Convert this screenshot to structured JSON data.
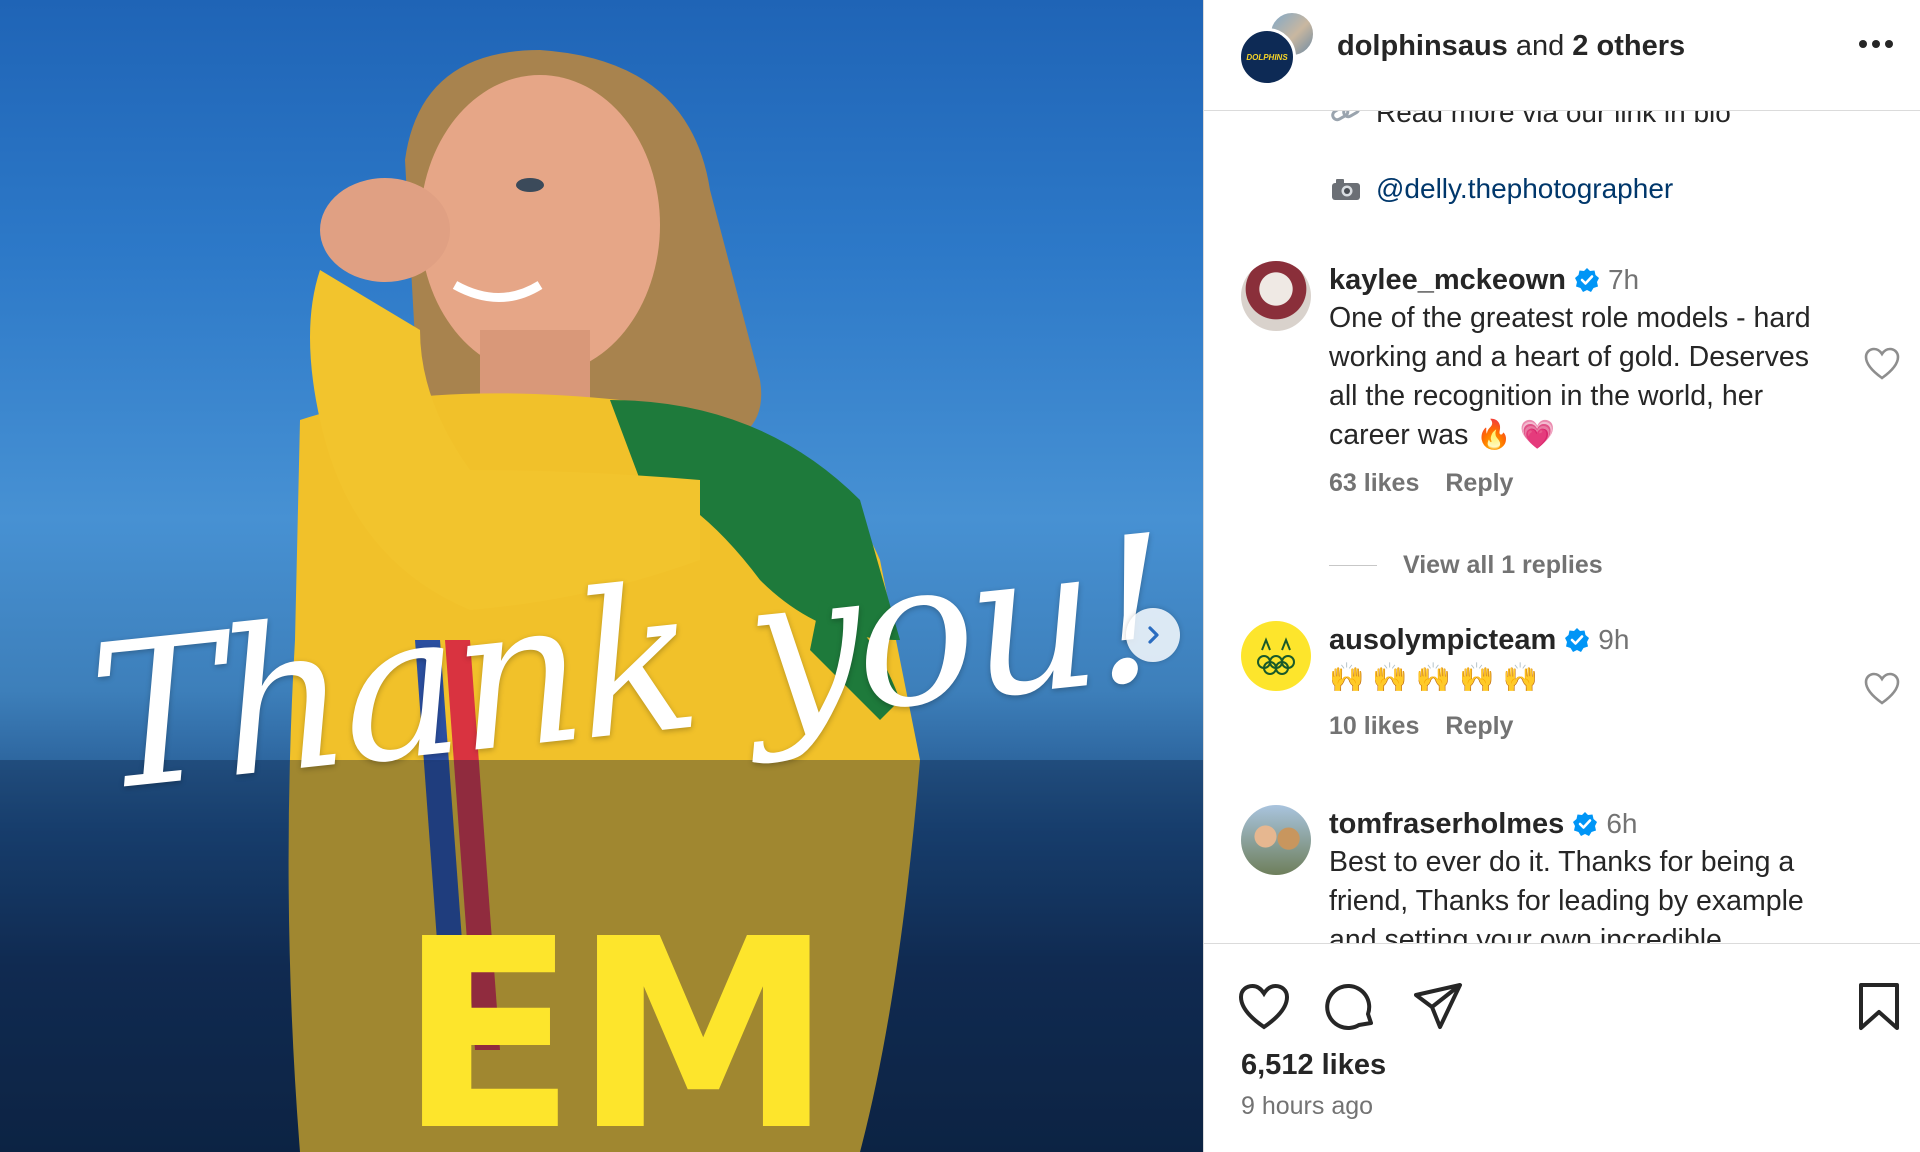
{
  "post": {
    "overlay_script": "Thank you!",
    "overlay_name": "EM",
    "next_icon": "chevron-right-icon"
  },
  "header": {
    "account": "dolphinsaus",
    "rest": " and ",
    "others": "2 others",
    "more_icon": "more-horizontal-icon"
  },
  "caption": {
    "line1_icon": "link-icon",
    "line1_text": "Read more via our link in bio",
    "line2_icon": "camera-icon",
    "line2_link": "@delly.thephotographer"
  },
  "comments": [
    {
      "username": "kaylee_mckeown",
      "verified": true,
      "time": "7h",
      "text": "One of the greatest role models - hard working and a heart of gold. Deserves all the recognition in the world, her career was 🔥 💗",
      "likes": "63 likes",
      "reply": "Reply",
      "view_replies": "View all 1 replies"
    },
    {
      "username": "ausolympicteam",
      "verified": true,
      "time": "9h",
      "text": "🙌 🙌 🙌 🙌 🙌",
      "likes": "10 likes",
      "reply": "Reply"
    },
    {
      "username": "tomfraserholmes",
      "verified": true,
      "time": "6h",
      "text": "Best to ever do it. Thanks for being a friend, Thanks for leading by example and setting your own incredible"
    }
  ],
  "actions": {
    "like_icon": "heart-icon",
    "comment_icon": "comment-icon",
    "share_icon": "send-icon",
    "save_icon": "bookmark-icon",
    "likes": "6,512 likes",
    "time_ago": "9 hours ago"
  },
  "colors": {
    "verified": "#0095f6",
    "link": "#00376b",
    "secondary_text": "#737373",
    "accent_yellow": "#fde52c"
  }
}
